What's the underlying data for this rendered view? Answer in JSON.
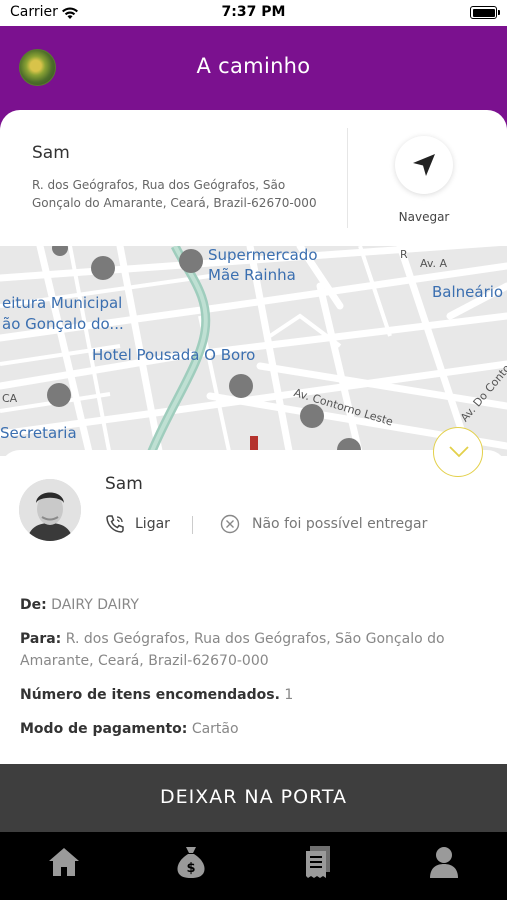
{
  "status_bar": {
    "carrier": "Carrier",
    "time": "7:37 PM"
  },
  "header": {
    "title": "A caminho"
  },
  "address_card": {
    "name": "Sam",
    "address": "R. dos Geógrafos, Rua dos Geógrafos, São Gonçalo do Amarante, Ceará, Brazil-62670-000",
    "navigate_label": "Navegar"
  },
  "map": {
    "labels": {
      "supermarket_line1": "Supermercado",
      "supermarket_line2": "Mãe Rainha",
      "av_a": "Av. A",
      "r_prefix": "R",
      "balneario": "Balneário c",
      "prefeitura_line1": "eitura Municipal",
      "prefeitura_line2": "ão Gonçalo do...",
      "hotel": "Hotel Pousada O Boro",
      "ca": "CA",
      "contorno_leste": "Av. Contorno Leste",
      "do_contorno": "Av. Do Contor",
      "secretaria": "Secretaria"
    }
  },
  "driver": {
    "name": "Sam",
    "call_label": "Ligar",
    "fail_label": "Não foi possível entregar"
  },
  "details": {
    "from_label": "De:",
    "from_value": "DAIRY DAIRY",
    "to_label": "Para:",
    "to_value": "R. dos Geógrafos, Rua dos Geógrafos, São Gonçalo do Amarante, Ceará, Brazil-62670-000",
    "items_label": "Número de itens encomendados.",
    "items_value": "1",
    "payment_label": "Modo de pagamento:",
    "payment_value": "Cartão"
  },
  "cta": {
    "label": "DEIXAR NA PORTA"
  },
  "tabbar": {
    "icons": [
      "home-icon",
      "money-bag-icon",
      "receipt-icon",
      "user-icon"
    ]
  },
  "colors": {
    "primary": "#7b118f",
    "cta_background": "#3e3e3e",
    "accent_ring": "#e3d04a"
  }
}
